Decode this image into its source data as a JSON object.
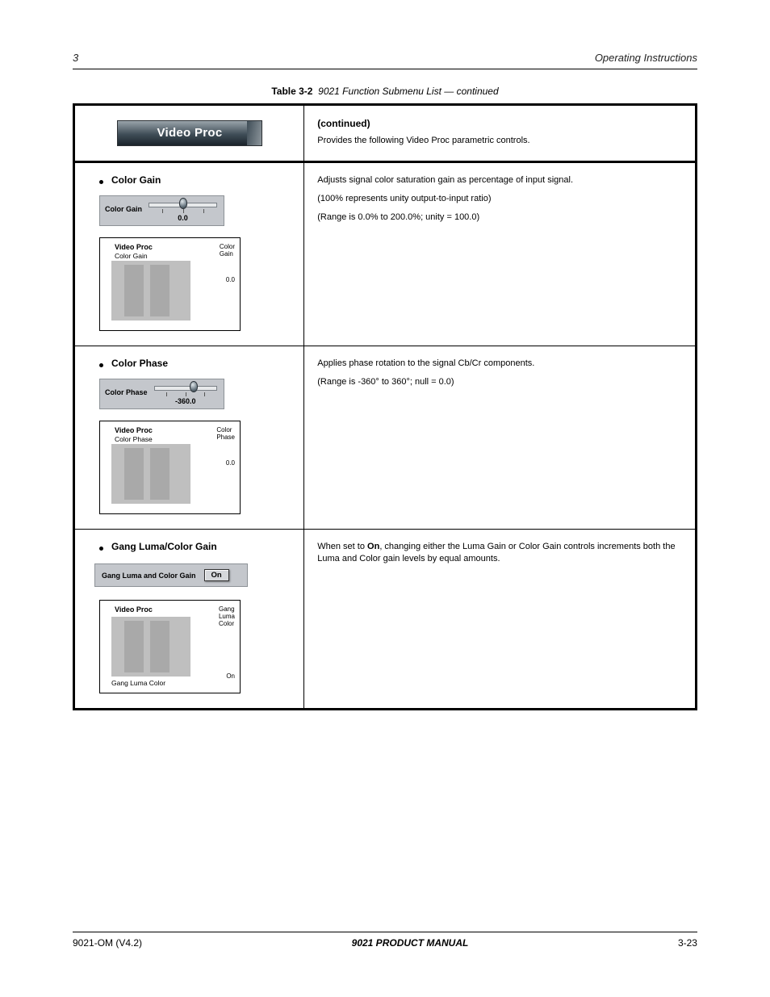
{
  "header": {
    "chapter": "3",
    "title": "Operating Instructions"
  },
  "caption": {
    "prefix": "Table 3-2",
    "text": "9021 Function Submenu List — continued"
  },
  "table": {
    "head": {
      "tab": "Video Proc",
      "line1": "(continued)",
      "line2": "Provides the following Video Proc parametric controls."
    },
    "rows": [
      {
        "func": "Color Gain",
        "widget": {
          "label": "Color Gain",
          "value": "0.0",
          "thumb_pct": 50
        },
        "ogcp": {
          "title": "Video Proc",
          "label_pos": "above",
          "label": "Color Gain",
          "side": [
            "Color",
            "Gain",
            "0.0"
          ]
        },
        "desc": [
          "Adjusts signal color saturation gain as percentage of input signal.",
          "(100% represents unity output-to-input ratio)",
          "(Range is 0.0% to 200.0%; unity = 100.0)"
        ]
      },
      {
        "func": "Color Phase",
        "widget": {
          "label": "Color Phase",
          "value": "-360.0",
          "thumb_pct": 62
        },
        "ogcp": {
          "title": "Video Proc",
          "label_pos": "above",
          "label": "Color Phase",
          "side": [
            "Color",
            "Phase",
            "0.0"
          ]
        },
        "desc": [
          "Applies phase rotation to the signal Cb/Cr components.",
          "(Range is -360° to 360°; null = 0.0)"
        ]
      },
      {
        "func": "Gang Luma/Color Gain",
        "toggle": {
          "label": "Gang Luma and Color Gain",
          "state": "On"
        },
        "ogcp": {
          "title": "Video Proc",
          "label_pos": "below",
          "label": "Gang Luma Color",
          "side": [
            "Gang",
            "Luma",
            "Color",
            "On"
          ]
        },
        "desc": [
          "When set to On, changing either the Luma Gain or Color Gain controls increments both the Luma and Color gain levels by equal amounts."
        ]
      }
    ]
  },
  "footer": {
    "left": "9021-OM (V4.2)",
    "mid": "9021 PRODUCT MANUAL",
    "right": "3-23"
  }
}
